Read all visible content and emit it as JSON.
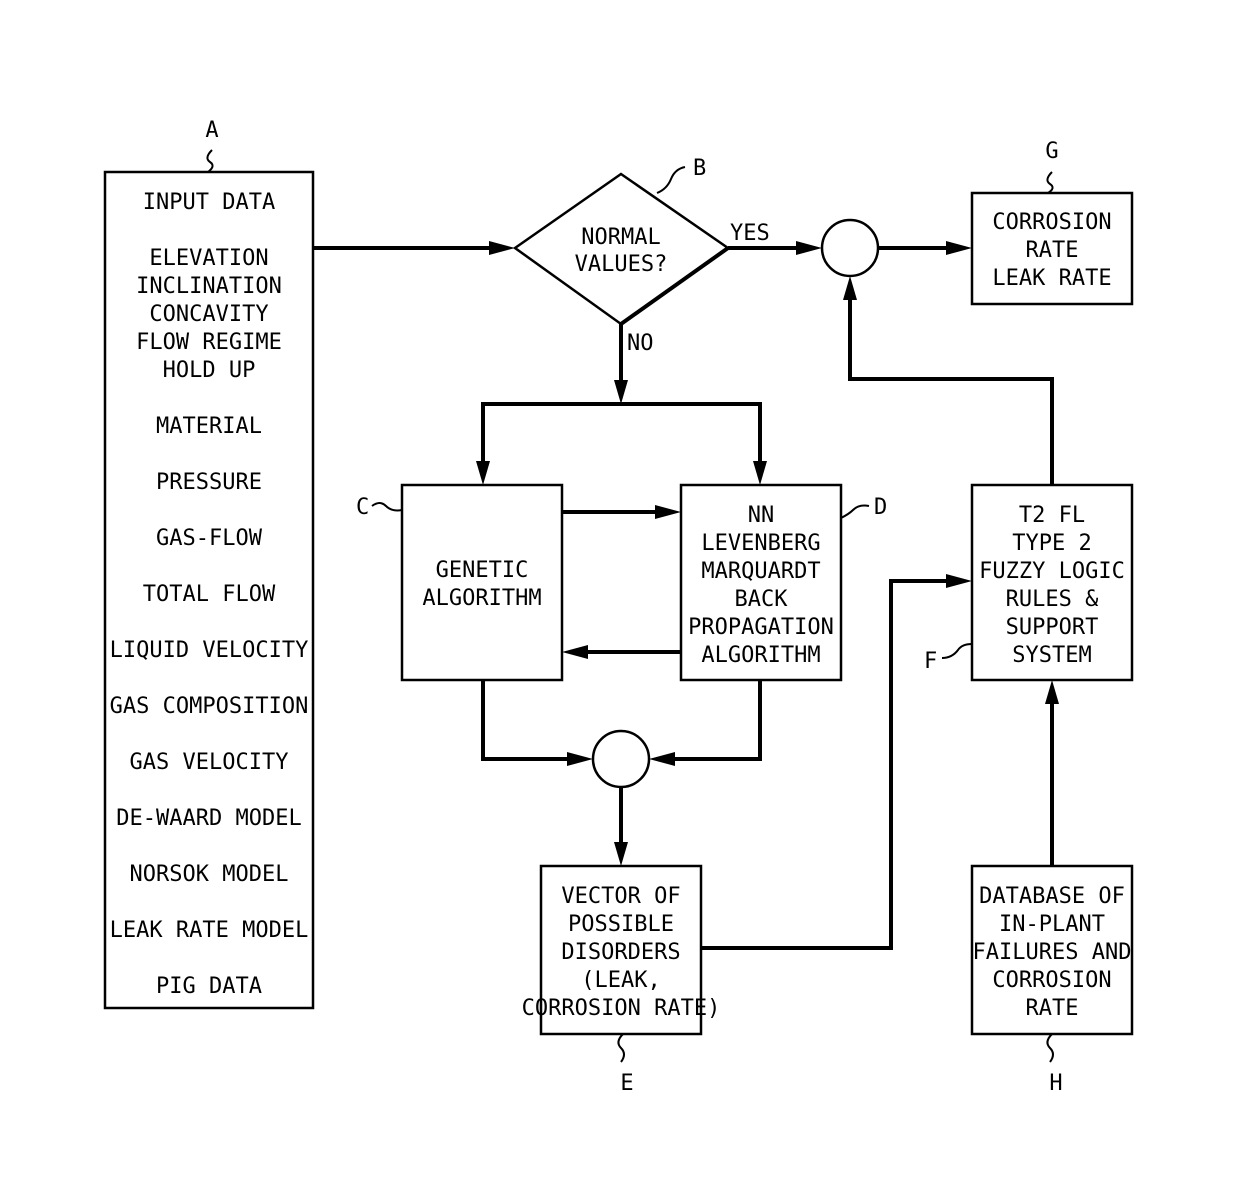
{
  "diagram": {
    "nodes": {
      "A": {
        "ref": "A",
        "groups": [
          [
            "INPUT DATA"
          ],
          [
            "ELEVATION",
            "INCLINATION",
            "CONCAVITY",
            "FLOW REGIME",
            "HOLD UP"
          ],
          [
            "MATERIAL"
          ],
          [
            "PRESSURE"
          ],
          [
            "GAS-FLOW"
          ],
          [
            "TOTAL FLOW"
          ],
          [
            "LIQUID VELOCITY"
          ],
          [
            "GAS COMPOSITION"
          ],
          [
            "GAS VELOCITY"
          ],
          [
            "DE-WAARD MODEL"
          ],
          [
            "NORSOK MODEL"
          ],
          [
            "LEAK RATE MODEL"
          ],
          [
            "PIG DATA"
          ]
        ]
      },
      "B": {
        "ref": "B",
        "lines": [
          "NORMAL",
          "VALUES?"
        ]
      },
      "C": {
        "ref": "C",
        "lines": [
          "GENETIC",
          "ALGORITHM"
        ]
      },
      "D": {
        "ref": "D",
        "lines": [
          "NN",
          "LEVENBERG",
          "MARQUARDT",
          "BACK",
          "PROPAGATION",
          "ALGORITHM"
        ]
      },
      "E": {
        "ref": "E",
        "lines": [
          "VECTOR OF",
          "POSSIBLE",
          "DISORDERS",
          "(LEAK,",
          "CORROSION RATE)"
        ]
      },
      "F": {
        "ref": "F",
        "lines": [
          "T2 FL",
          "TYPE 2",
          "FUZZY LOGIC",
          "RULES &",
          "SUPPORT",
          "SYSTEM"
        ]
      },
      "G": {
        "ref": "G",
        "lines": [
          "CORROSION",
          "RATE",
          "LEAK RATE"
        ]
      },
      "H": {
        "ref": "H",
        "lines": [
          "DATABASE OF",
          "IN-PLANT",
          "FAILURES AND",
          "CORROSION",
          "RATE"
        ]
      }
    },
    "edge_labels": {
      "yes": "YES",
      "no": "NO"
    },
    "edges": [
      [
        "A",
        "B"
      ],
      [
        "B",
        "junction-top",
        "YES"
      ],
      [
        "B",
        "C",
        "NO"
      ],
      [
        "B",
        "D",
        "NO"
      ],
      [
        "C",
        "D"
      ],
      [
        "D",
        "C"
      ],
      [
        "C",
        "junction-bottom"
      ],
      [
        "D",
        "junction-bottom"
      ],
      [
        "junction-bottom",
        "E"
      ],
      [
        "E",
        "F"
      ],
      [
        "H",
        "F"
      ],
      [
        "F",
        "junction-top"
      ],
      [
        "junction-top",
        "G"
      ]
    ]
  }
}
